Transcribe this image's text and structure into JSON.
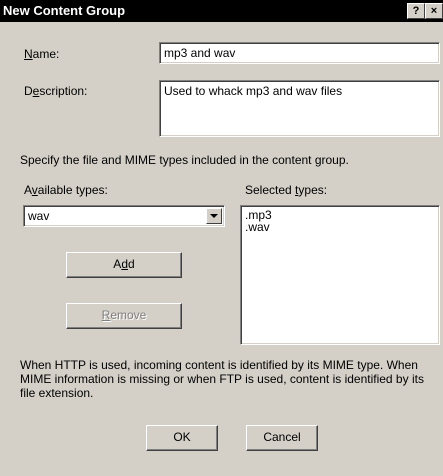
{
  "window": {
    "title": "New Content Group",
    "help_glyph": "?",
    "close_glyph": "×"
  },
  "name": {
    "label_pre": "",
    "label_key": "N",
    "label_post": "ame:",
    "value": "mp3 and wav"
  },
  "description": {
    "label_pre": "D",
    "label_key": "e",
    "label_post": "scription:",
    "value": "Used to whack mp3 and wav files"
  },
  "instructions": "Specify the file and MIME types included in the content group.",
  "available_types": {
    "label_pre": "A",
    "label_key": "v",
    "label_post": "ailable types:",
    "selected": "wav"
  },
  "selected_types": {
    "label_pre": "Selected ",
    "label_key": "t",
    "label_post": "ypes:",
    "items": [
      ".mp3",
      ".wav"
    ]
  },
  "add_button": {
    "pre": "A",
    "key": "d",
    "post": "d"
  },
  "remove_button": {
    "pre": "",
    "key": "R",
    "post": "emove",
    "disabled": true
  },
  "info_text": "When HTTP is used, incoming content is identified by its MIME type. When MIME information is missing or when FTP is used, content is identified by its file extension.",
  "ok_button": "OK",
  "cancel_button": "Cancel",
  "colors": {
    "face": "#d4d0c8",
    "titlebar": "#000000",
    "disabled_text": "#808080"
  }
}
